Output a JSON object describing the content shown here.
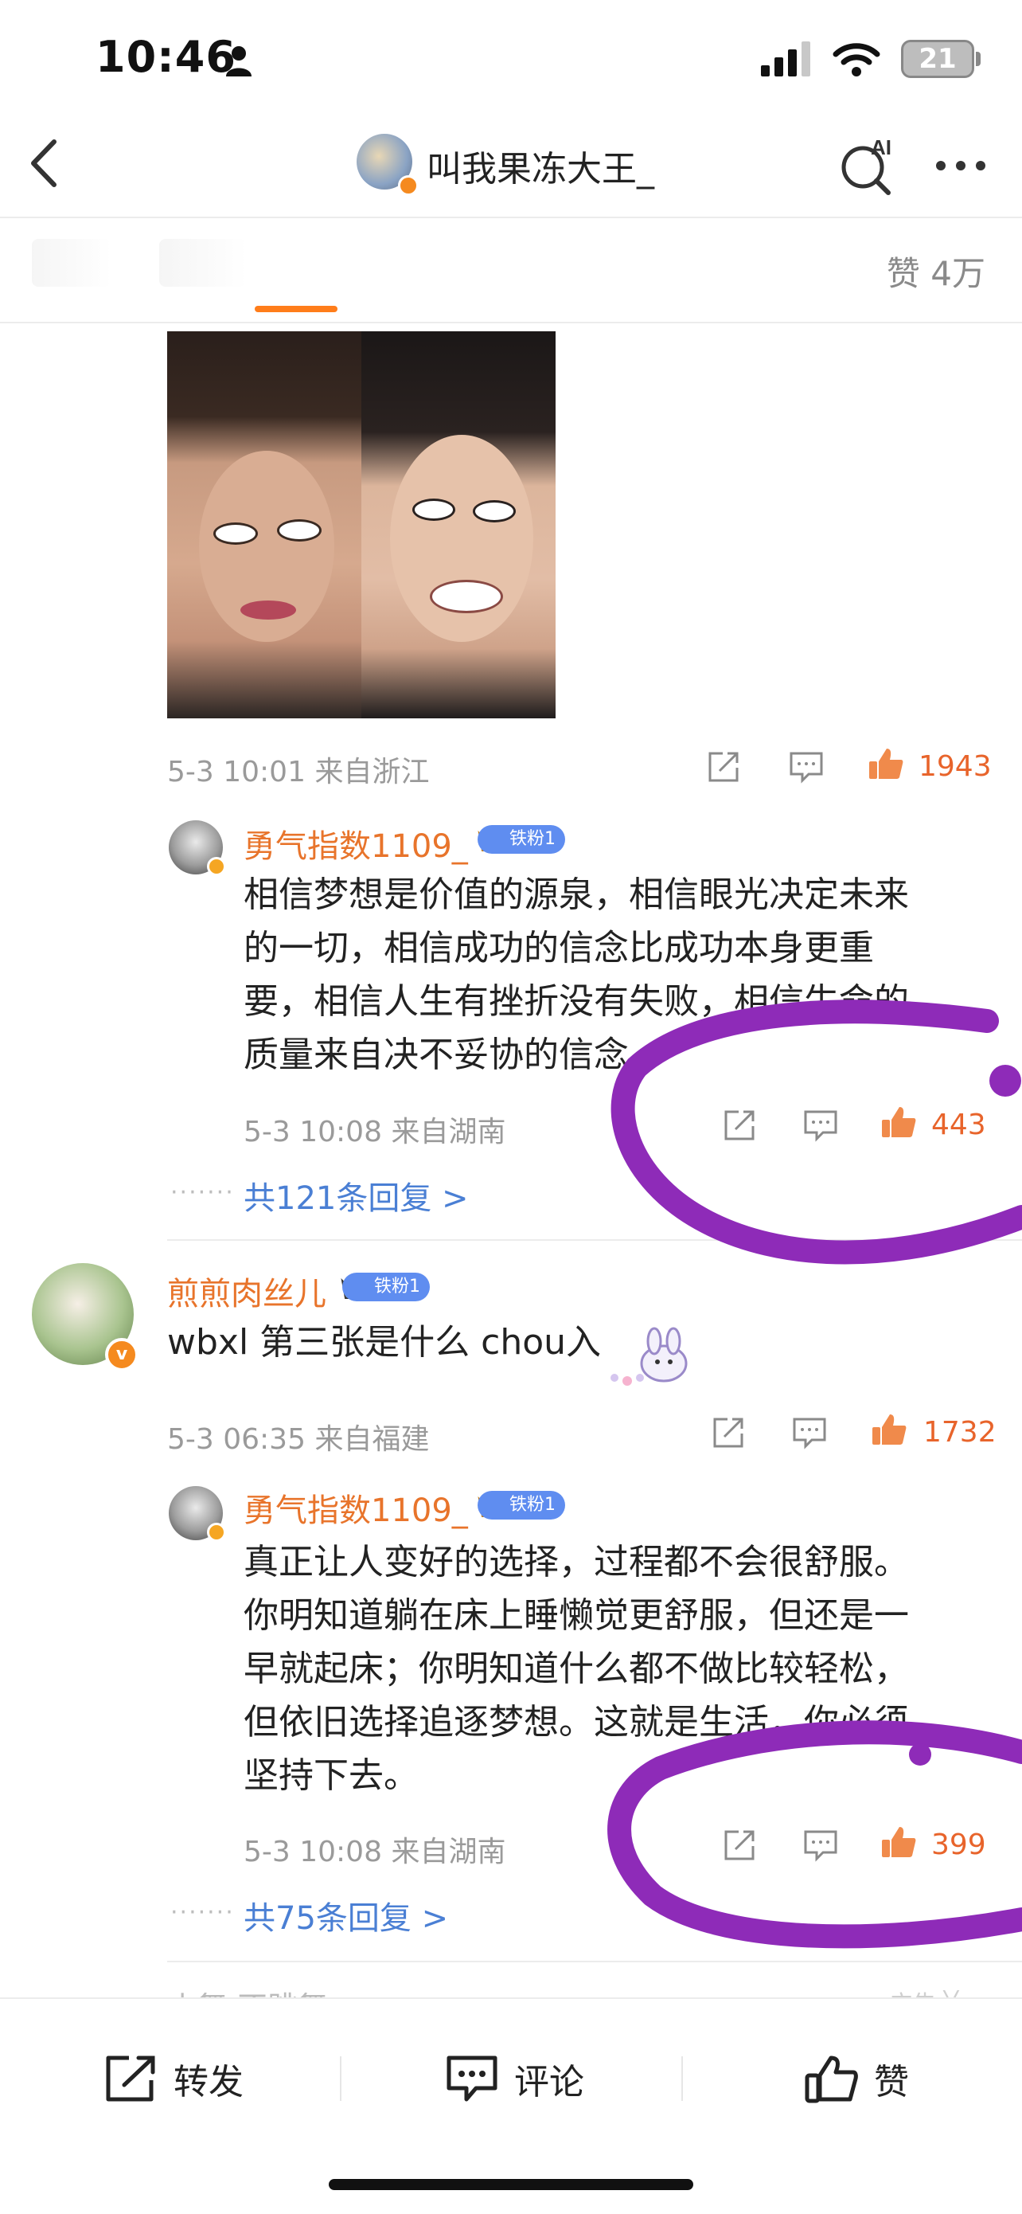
{
  "status_bar": {
    "time": "10:46",
    "battery": "21"
  },
  "nav": {
    "title": "叫我果冻大王_"
  },
  "tabs": {
    "likes_total": "赞 4万"
  },
  "post": {
    "date": "5-3 10:01",
    "location": "来自浙江",
    "likes": "1943"
  },
  "replies": [
    {
      "user": "勇气指数1109_",
      "fan_badge": "铁粉1",
      "text": "相信梦想是价值的源泉，相信眼光决定未来的一切，相信成功的信念比成功本身更重要，相信人生有挫折没有失败，相信生命的质量来自决不妥协的信念。",
      "lines": [
        "相信梦想是价值的源泉，相信眼光决定未来",
        "的一切，相信成功的信念比成功本身更重",
        "要，相信人生有挫折没有失败，相信生命的",
        "质量来自决不妥协的信念。"
      ],
      "date": "5-3 10:08",
      "location": "来自湖南",
      "likes": "443",
      "more_replies": "共121条回复 >"
    },
    {
      "user": "勇气指数1109_",
      "fan_badge": "铁粉1",
      "lines": [
        "真正让人变好的选择，过程都不会很舒服。",
        "你明知道躺在床上睡懒觉更舒服，但还是一",
        "早就起床；你明知道什么都不做比较轻松，",
        "但依旧选择追逐梦想。这就是生活，你必须",
        "坚持下去。"
      ],
      "date": "5-3 10:08",
      "location": "来自湖南",
      "likes": "399",
      "more_replies": "共75条回复 >"
    }
  ],
  "comment": {
    "user": "煎煎肉丝儿",
    "fan_badge": "铁粉1",
    "text": "wbxl 第三张是什么 chou入",
    "date": "5-3 06:35",
    "location": "来自福建",
    "likes": "1732"
  },
  "partial_next": {
    "user": "小舞  不跳舞",
    "ad": "广告 ╳"
  },
  "bottom_bar": {
    "repost": "转发",
    "comment": "评论",
    "like": "赞"
  },
  "colors": {
    "accent": "#ff7d1a",
    "like": "#e8642b",
    "link": "#4a7fd4",
    "marker": "#8e2bb8"
  }
}
